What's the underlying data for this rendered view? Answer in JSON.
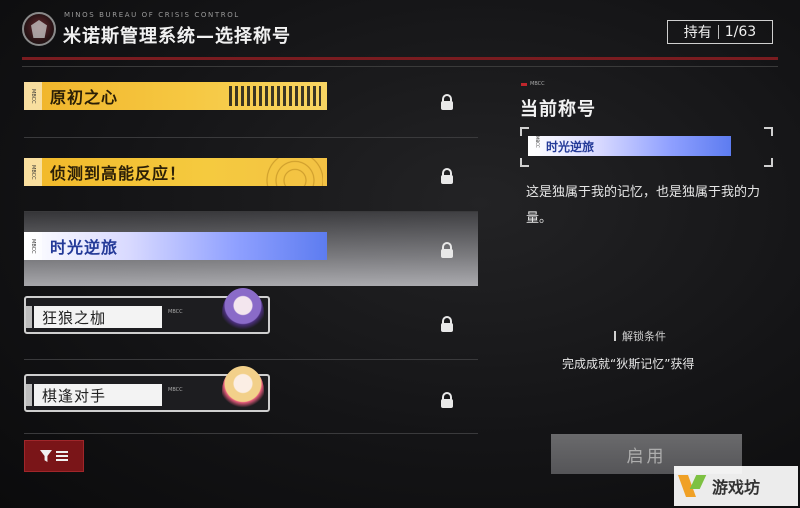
{
  "header": {
    "bureau": "MINOS BUREAU OF  CRISIS CONTROL",
    "title": "米诺斯管理系统—选择称号",
    "owned_label": "持有",
    "owned_value": "1/63"
  },
  "titles": [
    {
      "name": "原初之心",
      "tag": "MBCC",
      "style": "gold",
      "locked": true
    },
    {
      "name": "侦测到高能反应！",
      "tag": "MBCC",
      "style": "gold-rings",
      "locked": true
    },
    {
      "name": "时光逆旅",
      "tag": "MBCC",
      "style": "blue",
      "locked": true,
      "selected": true
    },
    {
      "name": "狂狼之枷",
      "tag": "MBCC",
      "style": "card",
      "locked": true
    },
    {
      "name": "棋逢对手",
      "tag": "MBCC",
      "style": "card",
      "locked": true
    }
  ],
  "panel": {
    "mbcc": "MBCC",
    "current_title_label": "当前称号",
    "preview_name": "时光逆旅",
    "preview_tag": "MBCC",
    "description": "这是独属于我的记忆，也是独属于我的力量。",
    "unlock_label": "解锁条件",
    "unlock_condition": "完成成就“狄斯记忆”获得",
    "enable_button": "启用"
  },
  "filter": {
    "icon": "filter-icon"
  },
  "watermark": {
    "text": "游戏坊"
  },
  "colors": {
    "accent_red": "#7a1518",
    "gold": "#f5c842",
    "blue": "#5d7cf0"
  }
}
